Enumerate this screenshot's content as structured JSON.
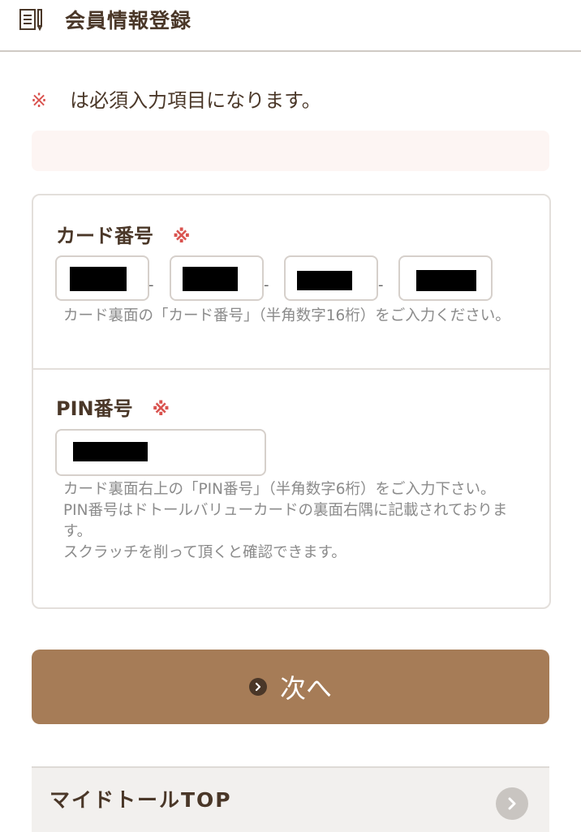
{
  "header": {
    "title": "会員情報登録",
    "icon": "document-icon"
  },
  "notice": {
    "mark": "※",
    "text": "は必須入力項目になります。"
  },
  "card_number": {
    "label": "カード番号",
    "required_mark": "※",
    "separator": "-",
    "help": "カード裏面の「カード番号」（半角数字16桁）をご入力ください。"
  },
  "pin": {
    "label": "PIN番号",
    "required_mark": "※",
    "help_lines": [
      "カード裏面右上の「PIN番号」（半角数字6桁）をご入力下さい。",
      "PIN番号はドトールバリューカードの裏面右隅に記載されております。",
      "スクラッチを削って頂くと確認できます。"
    ]
  },
  "next_button": {
    "label": "次へ",
    "icon": "chevron-right-circle-icon"
  },
  "mytop": {
    "label": "マイドトールTOP",
    "icon": "chevron-right-circle-icon"
  },
  "colors": {
    "accent": "#a67c57",
    "text": "#4a3728",
    "required": "#d9534f"
  }
}
